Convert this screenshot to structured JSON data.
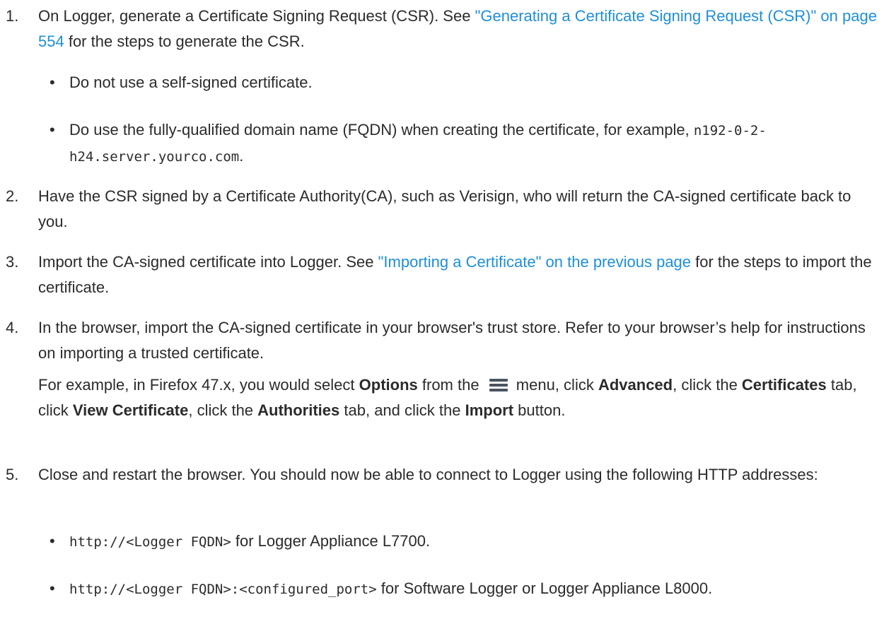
{
  "steps": [
    {
      "num": "1.",
      "text_before": "On Logger, generate a Certificate Signing Request (CSR). See ",
      "link": "\"Generating a Certificate Signing Request (CSR)\" on page 554",
      "text_after": " for the steps to generate the CSR.",
      "bullets": [
        {
          "text": "Do not use a self-signed certificate."
        },
        {
          "text_before": "Do use the fully-qualified domain name (FQDN) when creating the certificate, for example, ",
          "code": "n192-0-2-h24.server.yourco.com",
          "text_after": "."
        }
      ]
    },
    {
      "num": "2.",
      "text": "Have the CSR signed by a Certificate Authority(CA), such as Verisign, who will return the CA-signed certificate back to you."
    },
    {
      "num": "3.",
      "text_before": "Import the CA-signed certificate into Logger. See ",
      "link": "\"Importing a Certificate\" on the previous page",
      "text_after": " for the steps to import the certificate."
    },
    {
      "num": "4.",
      "text": "In the browser, import the CA-signed certificate in your browser's trust store. Refer to your browser’s help for instructions on importing a trusted certificate.",
      "example": {
        "t1": "For example, in Firefox 47.x, you would select ",
        "b1": "Options",
        "t2": " from the ",
        "icon": "hamburger-menu-icon",
        "t3": " menu, click ",
        "b2": "Advanced",
        "t4": ", click the ",
        "b3": "Certificates",
        "t5": " tab, click ",
        "b4": "View Certificate",
        "t6": ", click the ",
        "b5": "Authorities",
        "t7": " tab, and click the ",
        "b6": "Import",
        "t8": " button."
      }
    },
    {
      "num": "5.",
      "text": "Close and restart the browser. You should now be able to connect to Logger using the following HTTP addresses:",
      "bullets": [
        {
          "code": "http://<Logger FQDN>",
          "text_after": " for Logger Appliance L7700."
        },
        {
          "code": "http://<Logger FQDN>:<configured_port>",
          "text_after": " for Software Logger or Logger Appliance L8000."
        }
      ]
    }
  ]
}
